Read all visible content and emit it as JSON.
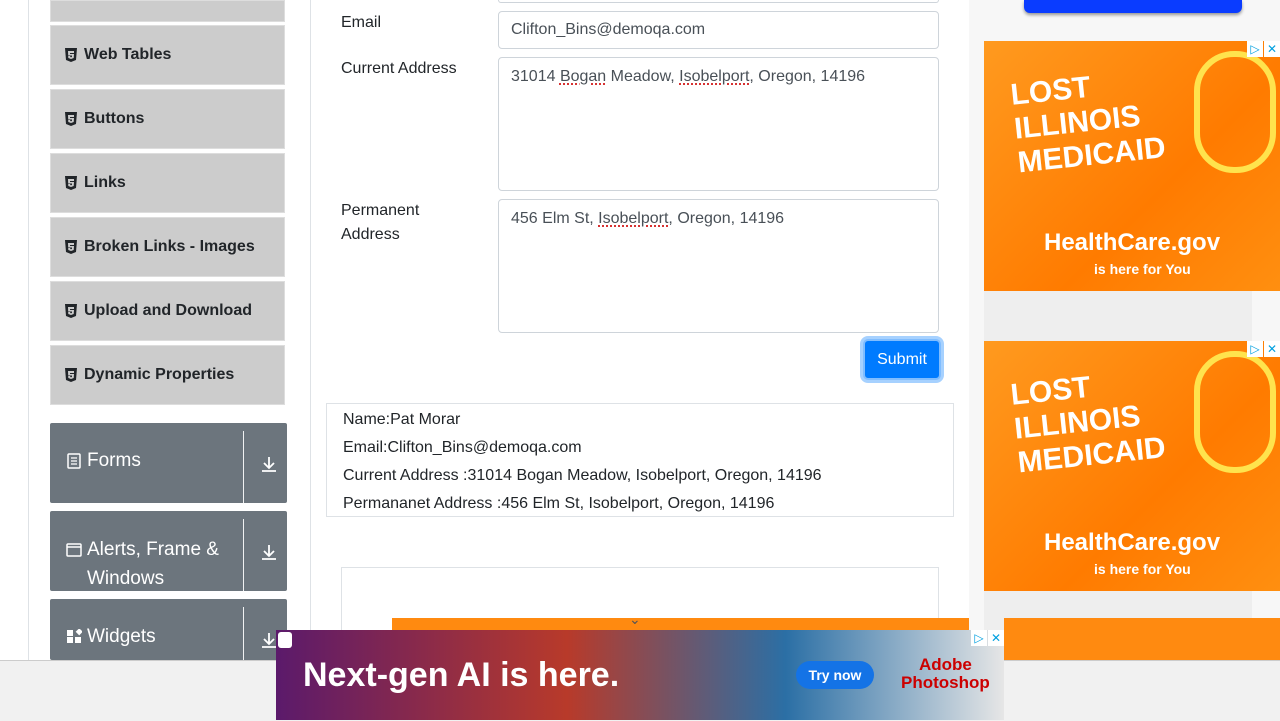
{
  "sidebar": {
    "items": [
      {
        "label": "Web Tables"
      },
      {
        "label": "Buttons"
      },
      {
        "label": "Links"
      },
      {
        "label": "Broken Links - Images"
      },
      {
        "label": "Upload and Download"
      },
      {
        "label": "Dynamic Properties"
      }
    ],
    "groups": [
      {
        "label": "Forms",
        "icon": "form-icon"
      },
      {
        "label": "Alerts, Frame & Windows",
        "label_line1": "Alerts, Frame &",
        "label_line2": "Windows",
        "icon": "window-icon"
      },
      {
        "label": "Widgets",
        "icon": "widgets-icon"
      }
    ]
  },
  "form": {
    "email_label": "Email",
    "email_value": "Clifton_Bins@demoqa.com",
    "current_address_label": "Current Address",
    "current_address_value": {
      "p1": "31014 ",
      "u1": "Bogan",
      "p2": " Meadow, ",
      "u2": "Isobelport",
      "p3": ", Oregon, 14196"
    },
    "permanent_address_label_line1": "Permanent",
    "permanent_address_label_line2": "Address",
    "permanent_address_value": {
      "p1": "456 Elm St, ",
      "u1": "Isobelport",
      "p2": ", Oregon, 14196"
    },
    "submit_label": "Submit"
  },
  "output": {
    "name": "Name:Pat Morar",
    "email": "Email:Clifton_Bins@demoqa.com",
    "current_address": "Current Address :31014 Bogan Meadow, Isobelport, Oregon, 14196",
    "permanent_address": "Permananet Address :456 Elm St, Isobelport, Oregon, 14196"
  },
  "ads": {
    "side_line1": "LOST",
    "side_line2": "ILLINOIS",
    "side_line3": "MEDICAID",
    "side_brand": "HealthCare.gov",
    "side_tagline": "is here for You",
    "bottom_headline": "Next-gen AI is here.",
    "bottom_cta": "Try now",
    "bottom_brand_line1": "Adobe",
    "bottom_brand_line2": "Photoshop"
  },
  "colors": {
    "primary": "#007bff",
    "sidebar_group_bg": "#6c757d",
    "sidebar_item_bg": "#cccccc"
  }
}
